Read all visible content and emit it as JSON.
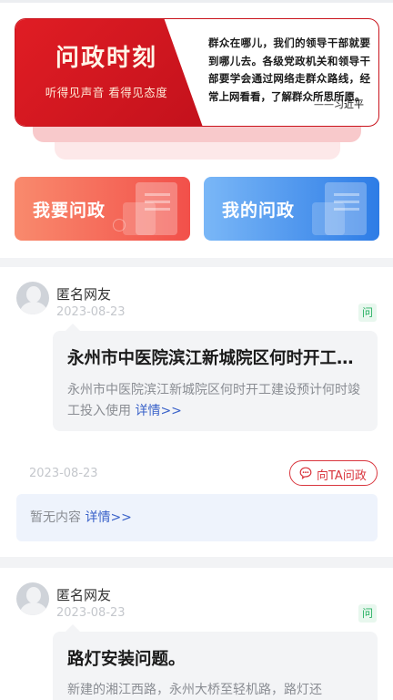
{
  "banner": {
    "title": "问政时刻",
    "subtitle": "听得见声音 看得见态度",
    "quote": "群众在哪儿，我们的领导干部就要到哪儿去。各级党政机关和领导干部要学会通过网络走群众路线，经常上网看看，了解群众所思所愿。",
    "author": "——习近平"
  },
  "actions": {
    "ask_label": "我要问政",
    "my_label": "我的问政"
  },
  "posts": [
    {
      "user": "匿名网友",
      "date": "2023-08-23",
      "tag": "问",
      "title": "永州市中医院滨江新城院区何时开工建设预计何时竣工投入使用",
      "body": "永州市中医院滨江新城院区何时开工建设预计何时竣工投入使用",
      "detail_label": "详情>>",
      "reply": {
        "date": "2023-08-23",
        "ask_ta_label": "向TA问政",
        "text": "暂无内容",
        "detail_label": "详情>>"
      }
    },
    {
      "user": "匿名网友",
      "date": "2023-08-23",
      "tag": "问",
      "title": "路灯安装问题。",
      "body": "新建的湘江西路，永州大桥至轻机路，路灯还",
      "detail_label": ""
    }
  ],
  "colors": {
    "brand_red": "#c9141d",
    "ask_gradient": [
      "#f98a6d",
      "#f2504a"
    ],
    "my_gradient": [
      "#7ab7f7",
      "#2d7ce6"
    ],
    "tag_green": "#27b062",
    "link_blue": "#3a62c9"
  }
}
